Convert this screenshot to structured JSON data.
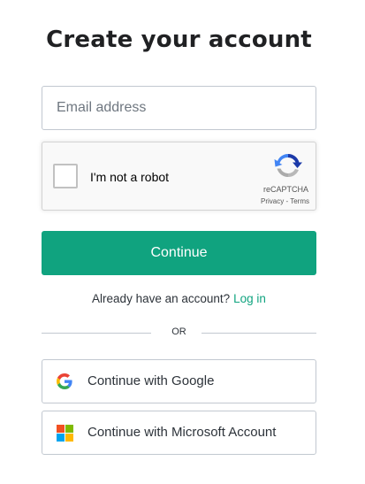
{
  "page": {
    "title": "Create your account"
  },
  "email": {
    "placeholder": "Email address",
    "value": ""
  },
  "recaptcha": {
    "label": "I'm not a robot",
    "brand": "reCAPTCHA",
    "privacy": "Privacy",
    "separator": " - ",
    "terms": "Terms",
    "checked": false
  },
  "continue_button": {
    "label": "Continue",
    "color": "#10a37f"
  },
  "login_prompt": {
    "text": "Already have an account?",
    "link": "Log in"
  },
  "divider": {
    "text": "OR"
  },
  "social": {
    "google": {
      "label": "Continue with Google",
      "icon": "google-icon"
    },
    "microsoft": {
      "label": "Continue with Microsoft Account",
      "icon": "microsoft-icon",
      "colors": [
        "#f25022",
        "#7fba00",
        "#00a4ef",
        "#ffb900"
      ]
    }
  }
}
